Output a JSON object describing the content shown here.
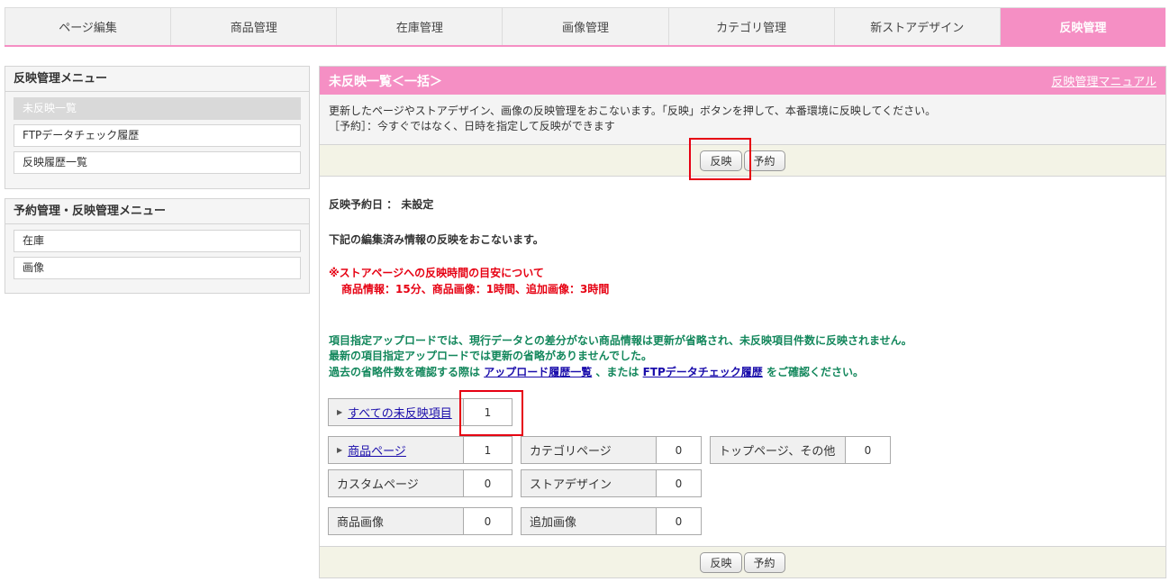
{
  "tabs": [
    {
      "label": "ページ編集",
      "active": false
    },
    {
      "label": "商品管理",
      "active": false
    },
    {
      "label": "在庫管理",
      "active": false
    },
    {
      "label": "画像管理",
      "active": false
    },
    {
      "label": "カテゴリ管理",
      "active": false
    },
    {
      "label": "新ストアデザイン",
      "active": false
    },
    {
      "label": "反映管理",
      "active": true
    }
  ],
  "sidebar": {
    "menu1": {
      "title": "反映管理メニュー",
      "items": [
        "未反映一覧",
        "FTPデータチェック履歴",
        "反映履歴一覧"
      ]
    },
    "menu2": {
      "title": "予約管理・反映管理メニュー",
      "items": [
        "在庫",
        "画像"
      ]
    }
  },
  "main": {
    "title": "未反映一覧＜一括＞",
    "manual_link": "反映管理マニュアル",
    "desc_line1": "更新したページやストアデザイン、画像の反映管理をおこないます。「反映」ボタンを押して、本番環境に反映してください。",
    "desc_line2": "［予約］：今すぐではなく、日時を指定して反映ができます",
    "buttons": {
      "reflect": "反映",
      "reserve": "予約"
    },
    "reserve_date": "反映予約日 ： 未設定",
    "intro": "下記の編集済み情報の反映をおこないます。",
    "notice_title": "※ストアページへの反映時間の目安について",
    "notice_detail": "商品情報：15分、商品画像：1時間、追加画像：3時間",
    "green_line1": "項目指定アップロードでは、現行データとの差分がない商品情報は更新が省略され、未反映項目件数に反映されません。",
    "green_line2": "最新の項目指定アップロードでは更新の省略がありませんでした。",
    "green_line3_a": "過去の省略件数を確認する際は",
    "green_link1": "アップロード履歴一覧",
    "green_line3_b": "、または",
    "green_link2": "FTPデータチェック履歴",
    "green_line3_c": "をご確認ください。",
    "counts": {
      "all": {
        "label": "すべての未反映項目",
        "value": "1"
      },
      "product_page": {
        "label": "商品ページ",
        "value": "1"
      },
      "category_page": {
        "label": "カテゴリページ",
        "value": "0"
      },
      "top_page": {
        "label": "トップページ、その他",
        "value": "0"
      },
      "custom_page": {
        "label": "カスタムページ",
        "value": "0"
      },
      "store_design": {
        "label": "ストアデザイン",
        "value": "0"
      },
      "product_image": {
        "label": "商品画像",
        "value": "0"
      },
      "extra_image": {
        "label": "追加画像",
        "value": "0"
      }
    }
  },
  "colors": {
    "accent": "#f58fc4",
    "highlight": "#e60012",
    "green_text": "#13875c"
  }
}
